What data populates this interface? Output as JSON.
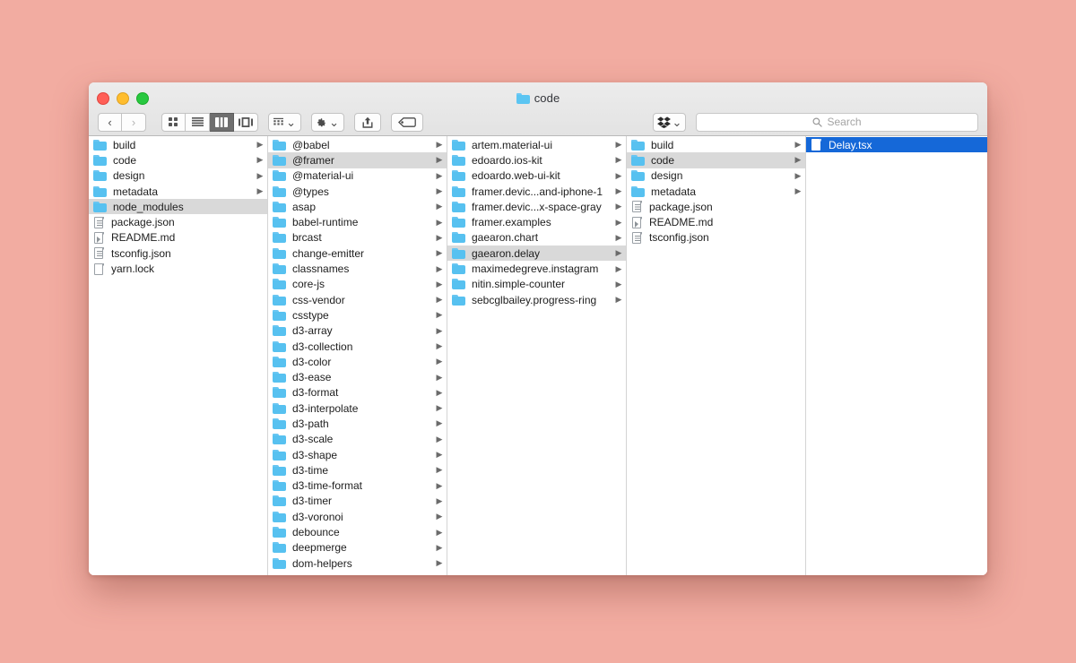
{
  "desktop": {
    "background_color": "#f2aca1"
  },
  "window": {
    "title": "code",
    "title_icon": "folder-icon",
    "traffic_lights": [
      {
        "name": "close-button",
        "color": "#ff5f57"
      },
      {
        "name": "minimize-button",
        "color": "#ffbd2e"
      },
      {
        "name": "maximize-button",
        "color": "#28c840"
      }
    ]
  },
  "toolbar": {
    "back_label": "‹",
    "forward_label": "›",
    "view_modes": [
      {
        "name": "icon-view",
        "selected": false
      },
      {
        "name": "list-view",
        "selected": false
      },
      {
        "name": "column-view",
        "selected": true
      },
      {
        "name": "gallery-view",
        "selected": false
      }
    ],
    "group_button": "arrange-icon",
    "action_button": "gear-icon",
    "share_button": "share-icon",
    "tag_button": "tag-icon",
    "dropbox_button": "dropbox-icon",
    "chevron": "⌄"
  },
  "search": {
    "placeholder": "Search",
    "value": "",
    "icon": "search-icon"
  },
  "columns": [
    {
      "name": "column-1",
      "items": [
        {
          "label": "build",
          "type": "folder",
          "arrow": true,
          "selected": "none"
        },
        {
          "label": "code",
          "type": "folder",
          "arrow": true,
          "selected": "none"
        },
        {
          "label": "design",
          "type": "folder",
          "arrow": true,
          "selected": "none"
        },
        {
          "label": "metadata",
          "type": "folder",
          "arrow": true,
          "selected": "none"
        },
        {
          "label": "node_modules",
          "type": "folder",
          "arrow": false,
          "selected": "gray"
        },
        {
          "label": "package.json",
          "type": "file-lines",
          "arrow": false,
          "selected": "none"
        },
        {
          "label": "README.md",
          "type": "file-marked",
          "arrow": false,
          "selected": "none"
        },
        {
          "label": "tsconfig.json",
          "type": "file-lines",
          "arrow": false,
          "selected": "none"
        },
        {
          "label": "yarn.lock",
          "type": "file-plain",
          "arrow": false,
          "selected": "none"
        }
      ]
    },
    {
      "name": "column-2",
      "items": [
        {
          "label": "@babel",
          "type": "folder",
          "arrow": true,
          "selected": "none"
        },
        {
          "label": "@framer",
          "type": "folder",
          "arrow": true,
          "selected": "gray"
        },
        {
          "label": "@material-ui",
          "type": "folder",
          "arrow": true,
          "selected": "none"
        },
        {
          "label": "@types",
          "type": "folder",
          "arrow": true,
          "selected": "none"
        },
        {
          "label": "asap",
          "type": "folder",
          "arrow": true,
          "selected": "none"
        },
        {
          "label": "babel-runtime",
          "type": "folder",
          "arrow": true,
          "selected": "none"
        },
        {
          "label": "brcast",
          "type": "folder",
          "arrow": true,
          "selected": "none"
        },
        {
          "label": "change-emitter",
          "type": "folder",
          "arrow": true,
          "selected": "none"
        },
        {
          "label": "classnames",
          "type": "folder",
          "arrow": true,
          "selected": "none"
        },
        {
          "label": "core-js",
          "type": "folder",
          "arrow": true,
          "selected": "none"
        },
        {
          "label": "css-vendor",
          "type": "folder",
          "arrow": true,
          "selected": "none"
        },
        {
          "label": "csstype",
          "type": "folder",
          "arrow": true,
          "selected": "none"
        },
        {
          "label": "d3-array",
          "type": "folder",
          "arrow": true,
          "selected": "none"
        },
        {
          "label": "d3-collection",
          "type": "folder",
          "arrow": true,
          "selected": "none"
        },
        {
          "label": "d3-color",
          "type": "folder",
          "arrow": true,
          "selected": "none"
        },
        {
          "label": "d3-ease",
          "type": "folder",
          "arrow": true,
          "selected": "none"
        },
        {
          "label": "d3-format",
          "type": "folder",
          "arrow": true,
          "selected": "none"
        },
        {
          "label": "d3-interpolate",
          "type": "folder",
          "arrow": true,
          "selected": "none"
        },
        {
          "label": "d3-path",
          "type": "folder",
          "arrow": true,
          "selected": "none"
        },
        {
          "label": "d3-scale",
          "type": "folder",
          "arrow": true,
          "selected": "none"
        },
        {
          "label": "d3-shape",
          "type": "folder",
          "arrow": true,
          "selected": "none"
        },
        {
          "label": "d3-time",
          "type": "folder",
          "arrow": true,
          "selected": "none"
        },
        {
          "label": "d3-time-format",
          "type": "folder",
          "arrow": true,
          "selected": "none"
        },
        {
          "label": "d3-timer",
          "type": "folder",
          "arrow": true,
          "selected": "none"
        },
        {
          "label": "d3-voronoi",
          "type": "folder",
          "arrow": true,
          "selected": "none"
        },
        {
          "label": "debounce",
          "type": "folder",
          "arrow": true,
          "selected": "none"
        },
        {
          "label": "deepmerge",
          "type": "folder",
          "arrow": true,
          "selected": "none"
        },
        {
          "label": "dom-helpers",
          "type": "folder",
          "arrow": true,
          "selected": "none"
        }
      ]
    },
    {
      "name": "column-3",
      "items": [
        {
          "label": "artem.material-ui",
          "type": "folder",
          "arrow": true,
          "selected": "none"
        },
        {
          "label": "edoardo.ios-kit",
          "type": "folder",
          "arrow": true,
          "selected": "none"
        },
        {
          "label": "edoardo.web-ui-kit",
          "type": "folder",
          "arrow": true,
          "selected": "none"
        },
        {
          "label": "framer.devic...and-iphone-1",
          "type": "folder",
          "arrow": true,
          "selected": "none"
        },
        {
          "label": "framer.devic...x-space-gray",
          "type": "folder",
          "arrow": true,
          "selected": "none"
        },
        {
          "label": "framer.examples",
          "type": "folder",
          "arrow": true,
          "selected": "none"
        },
        {
          "label": "gaearon.chart",
          "type": "folder",
          "arrow": true,
          "selected": "none"
        },
        {
          "label": "gaearon.delay",
          "type": "folder",
          "arrow": true,
          "selected": "gray"
        },
        {
          "label": "maximedegreve.instagram",
          "type": "folder",
          "arrow": true,
          "selected": "none"
        },
        {
          "label": "nitin.simple-counter",
          "type": "folder",
          "arrow": true,
          "selected": "none"
        },
        {
          "label": "sebcglbailey.progress-ring",
          "type": "folder",
          "arrow": true,
          "selected": "none"
        }
      ]
    },
    {
      "name": "column-4",
      "items": [
        {
          "label": "build",
          "type": "folder",
          "arrow": true,
          "selected": "none"
        },
        {
          "label": "code",
          "type": "folder",
          "arrow": true,
          "selected": "gray"
        },
        {
          "label": "design",
          "type": "folder",
          "arrow": true,
          "selected": "none"
        },
        {
          "label": "metadata",
          "type": "folder",
          "arrow": true,
          "selected": "none"
        },
        {
          "label": "package.json",
          "type": "file-lines",
          "arrow": false,
          "selected": "none"
        },
        {
          "label": "README.md",
          "type": "file-marked",
          "arrow": false,
          "selected": "none"
        },
        {
          "label": "tsconfig.json",
          "type": "file-lines",
          "arrow": false,
          "selected": "none"
        }
      ]
    },
    {
      "name": "column-5",
      "items": [
        {
          "label": "Delay.tsx",
          "type": "file-plain",
          "arrow": false,
          "selected": "blue"
        }
      ]
    }
  ],
  "colors": {
    "selection_blue": "#1568d8",
    "selection_gray": "#d9d9d9",
    "folder_blue": "#57c1f0",
    "toolbar_gray": "#e9e9e9"
  }
}
